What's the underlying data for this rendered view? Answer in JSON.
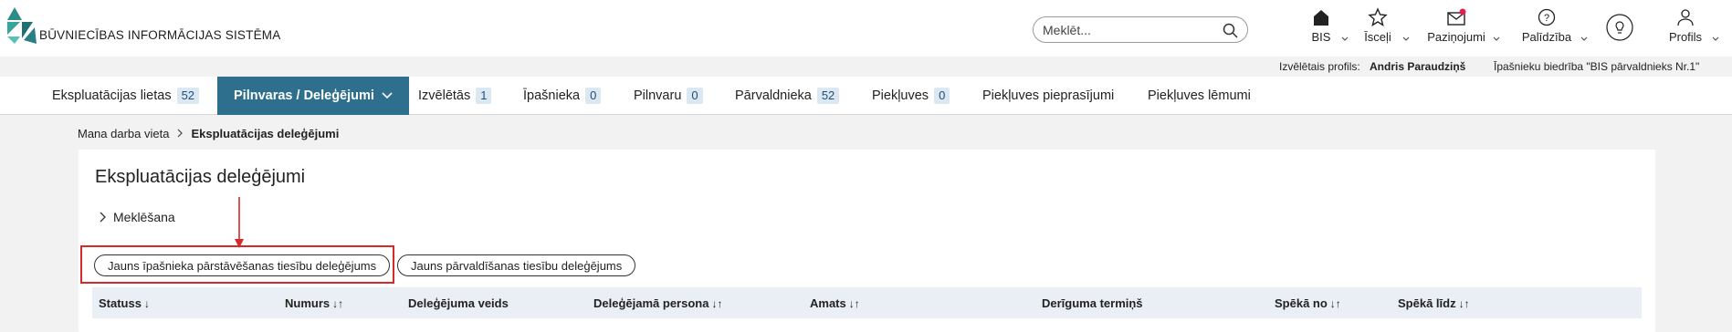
{
  "app": {
    "logo_text": "BŪVNIECĪBAS INFORMĀCIJAS SISTĒMA"
  },
  "search": {
    "placeholder": "Meklēt..."
  },
  "top_nav": {
    "bis": "BIS",
    "favorites": "Īsceļi",
    "notifications": "Paziņojumi",
    "help": "Palīdzība",
    "profile": "Profils"
  },
  "profile_strip": {
    "label": "Izvēlētais profils:",
    "name": "Andris Paraudziņš",
    "org": "Īpašnieku biedrība \"BIS pārvaldnieks Nr.1\""
  },
  "tabs": [
    {
      "label": "Ekspluatācijas lietas",
      "badge": "52"
    },
    {
      "label": "Pilnvaras / Deleģējumi",
      "badge": ""
    },
    {
      "label": "Izvēlētās",
      "badge": "1"
    },
    {
      "label": "Īpašnieka",
      "badge": "0"
    },
    {
      "label": "Pilnvaru",
      "badge": "0"
    },
    {
      "label": "Pārvaldnieka",
      "badge": "52"
    },
    {
      "label": "Piekļuves",
      "badge": "0"
    },
    {
      "label": "Piekļuves pieprasījumi",
      "badge": ""
    },
    {
      "label": "Piekļuves lēmumi",
      "badge": ""
    }
  ],
  "breadcrumb": {
    "home": "Mana darba vieta",
    "current": "Ekspluatācijas deleģējumi"
  },
  "page": {
    "title": "Ekspluatācijas deleģējumi",
    "search_toggle": "Meklēšana",
    "btn_owner": "Jauns īpašnieka pārstāvēšanas tiesību deleģējums",
    "btn_management": "Jauns pārvaldīšanas tiesību deleģējums"
  },
  "table": {
    "columns": [
      {
        "label": "Statuss",
        "sort": "↓"
      },
      {
        "label": "Numurs",
        "sort": "↓↑"
      },
      {
        "label": "Deleģējuma veids",
        "sort": ""
      },
      {
        "label": "Deleģējamā persona",
        "sort": "↓↑"
      },
      {
        "label": "Amats",
        "sort": "↓↑"
      },
      {
        "label": "Derīguma termiņš",
        "sort": ""
      },
      {
        "label": "Spēkā no",
        "sort": "↓↑"
      },
      {
        "label": "Spēkā līdz",
        "sort": "↓↑"
      }
    ]
  },
  "colors": {
    "accent": "#2e6f8e",
    "highlight": "#d42a2a",
    "badge_bg": "#dbe8f2",
    "notification_dot": "#e0204a"
  }
}
